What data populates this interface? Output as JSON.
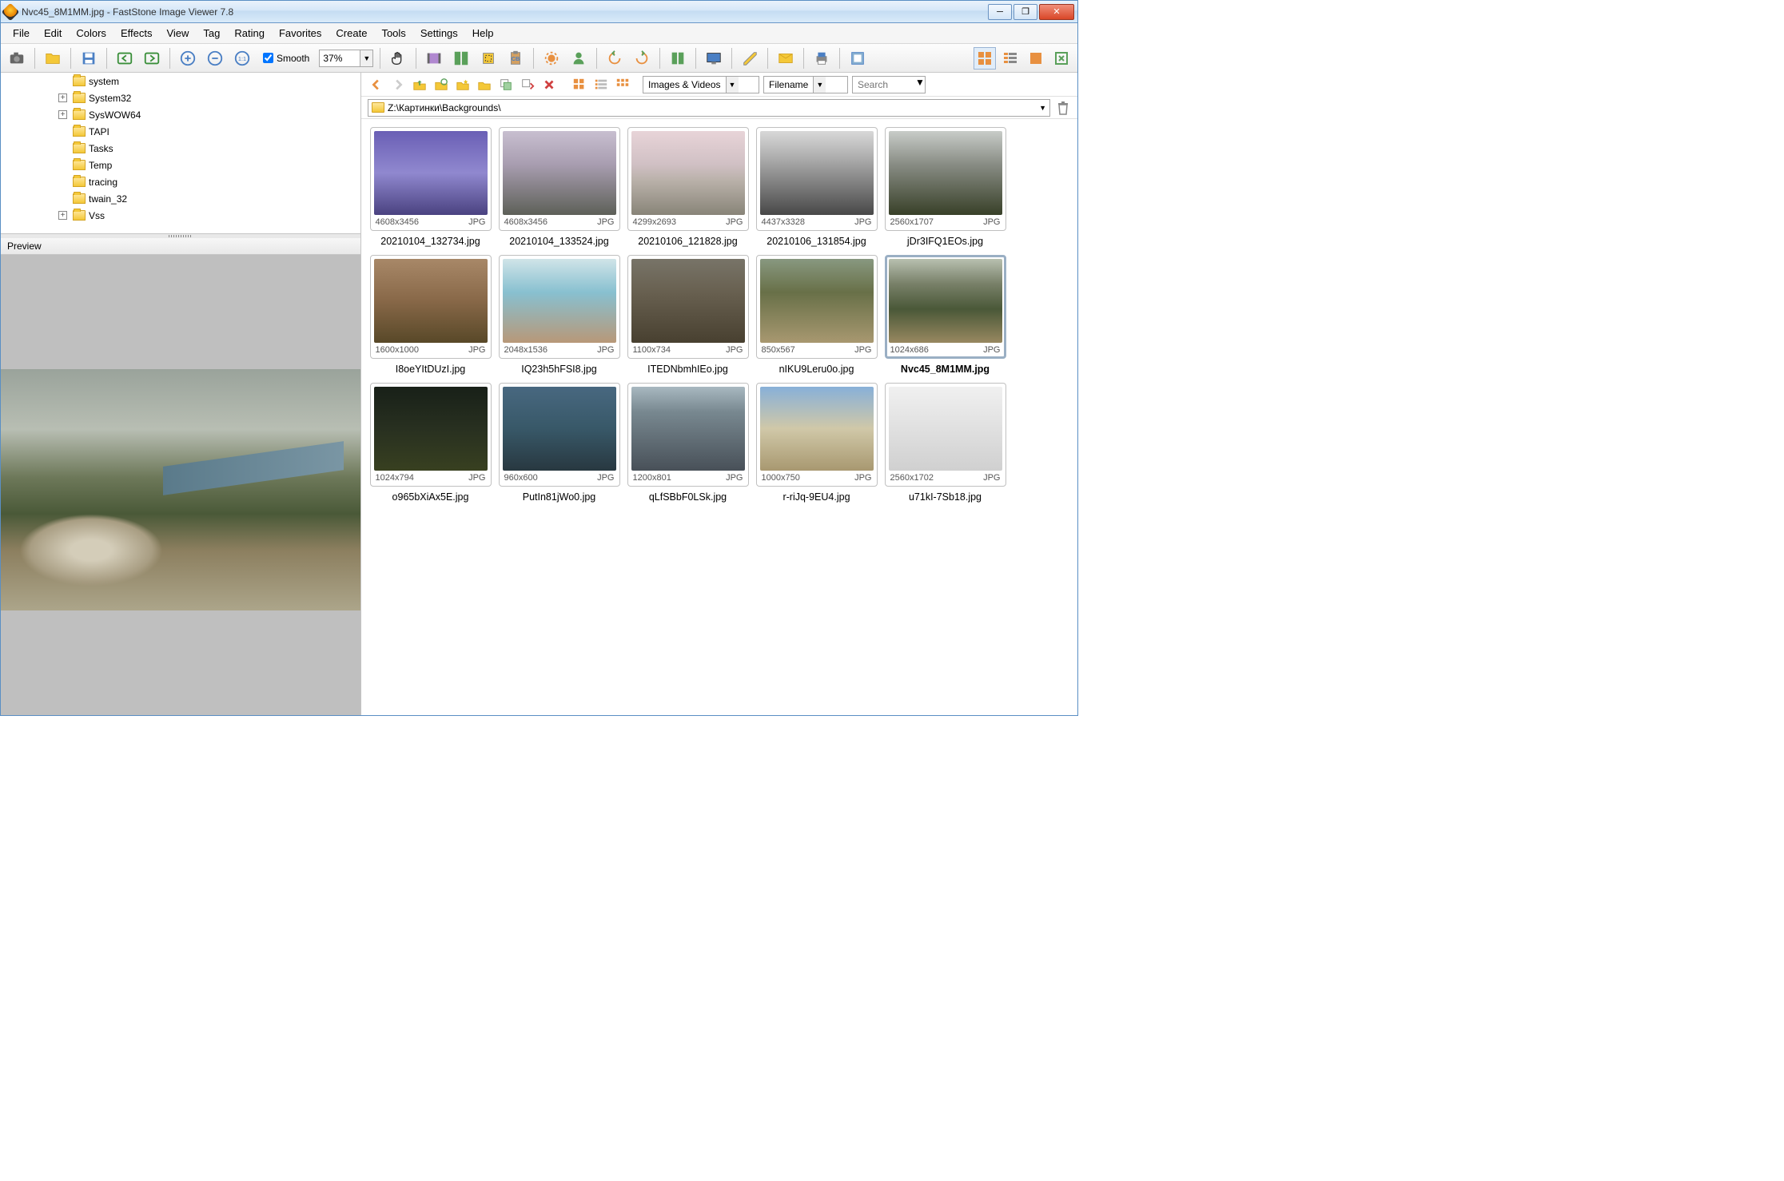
{
  "title": "Nvc45_8M1MM.jpg  -  FastStone Image Viewer 7.8",
  "menu": [
    "File",
    "Edit",
    "Colors",
    "Effects",
    "View",
    "Tag",
    "Rating",
    "Favorites",
    "Create",
    "Tools",
    "Settings",
    "Help"
  ],
  "smooth_label": "Smooth",
  "smooth_checked": true,
  "zoom": "37%",
  "tree": [
    {
      "name": "system",
      "expandable": false
    },
    {
      "name": "System32",
      "expandable": true
    },
    {
      "name": "SysWOW64",
      "expandable": true
    },
    {
      "name": "TAPI",
      "expandable": false
    },
    {
      "name": "Tasks",
      "expandable": false
    },
    {
      "name": "Temp",
      "expandable": false
    },
    {
      "name": "tracing",
      "expandable": false
    },
    {
      "name": "twain_32",
      "expandable": false
    },
    {
      "name": "Vss",
      "expandable": true
    }
  ],
  "preview_label": "Preview",
  "filter": {
    "type_label": "Images & Videos",
    "sort_label": "Filename",
    "search_placeholder": "Search"
  },
  "path": "Z:\\Картинки\\Backgrounds\\",
  "thumbs": [
    {
      "dim": "4608x3456",
      "fmt": "JPG",
      "name": "20210104_132734.jpg",
      "sel": false,
      "cls": "tg0"
    },
    {
      "dim": "4608x3456",
      "fmt": "JPG",
      "name": "20210104_133524.jpg",
      "sel": false,
      "cls": "tg1"
    },
    {
      "dim": "4299x2693",
      "fmt": "JPG",
      "name": "20210106_121828.jpg",
      "sel": false,
      "cls": "tg2"
    },
    {
      "dim": "4437x3328",
      "fmt": "JPG",
      "name": "20210106_131854.jpg",
      "sel": false,
      "cls": "tg3"
    },
    {
      "dim": "2560x1707",
      "fmt": "JPG",
      "name": "jDr3IFQ1EOs.jpg",
      "sel": false,
      "cls": "tg4"
    },
    {
      "dim": "1600x1000",
      "fmt": "JPG",
      "name": "I8oeYItDUzI.jpg",
      "sel": false,
      "cls": "tg5"
    },
    {
      "dim": "2048x1536",
      "fmt": "JPG",
      "name": "IQ23h5hFSI8.jpg",
      "sel": false,
      "cls": "tg6"
    },
    {
      "dim": "1100x734",
      "fmt": "JPG",
      "name": "ITEDNbmhIEo.jpg",
      "sel": false,
      "cls": "tg7"
    },
    {
      "dim": "850x567",
      "fmt": "JPG",
      "name": "nIKU9Leru0o.jpg",
      "sel": false,
      "cls": "tg8"
    },
    {
      "dim": "1024x686",
      "fmt": "JPG",
      "name": "Nvc45_8M1MM.jpg",
      "sel": true,
      "cls": "tg9"
    },
    {
      "dim": "1024x794",
      "fmt": "JPG",
      "name": "o965bXiAx5E.jpg",
      "sel": false,
      "cls": "tg10"
    },
    {
      "dim": "960x600",
      "fmt": "JPG",
      "name": "PutIn81jWo0.jpg",
      "sel": false,
      "cls": "tg11"
    },
    {
      "dim": "1200x801",
      "fmt": "JPG",
      "name": "qLfSBbF0LSk.jpg",
      "sel": false,
      "cls": "tg12"
    },
    {
      "dim": "1000x750",
      "fmt": "JPG",
      "name": "r-riJq-9EU4.jpg",
      "sel": false,
      "cls": "tg13"
    },
    {
      "dim": "2560x1702",
      "fmt": "JPG",
      "name": "u71kI-7Sb18.jpg",
      "sel": false,
      "cls": "tg14"
    }
  ]
}
